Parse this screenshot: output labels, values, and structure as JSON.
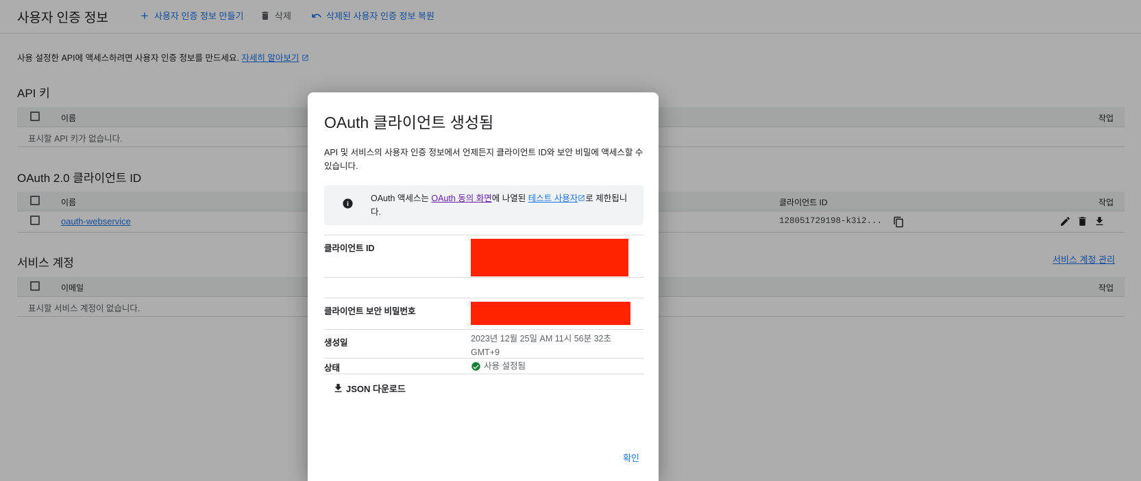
{
  "header": {
    "title": "사용자 인증 정보",
    "create_label": "사용자 인증 정보 만들기",
    "delete_label": "삭제",
    "restore_label": "삭제된 사용자 인증 정보 복원"
  },
  "intro": {
    "text": "사용 설정한 API에 액세스하려면 사용자 인증 정보를 만드세요.",
    "link": "자세히 알아보기"
  },
  "api_keys": {
    "title": "API 키",
    "col_name": "이름",
    "col_action": "작업",
    "empty": "표시할 API 키가 없습니다."
  },
  "oauth": {
    "title": "OAuth 2.0 클라이언트 ID",
    "col_name": "이름",
    "col_client_id": "클라이언트 ID",
    "col_action": "작업",
    "rows": [
      {
        "name": "oauth-webservice",
        "client_id": "128051729198-k3i2..."
      }
    ]
  },
  "service_accounts": {
    "title": "서비스 계정",
    "manage_link": "서비스 계정 관리",
    "col_email": "이메일",
    "col_action": "작업",
    "empty": "표시할 서비스 계정이 없습니다."
  },
  "dialog": {
    "title": "OAuth 클라이언트 생성됨",
    "description": "API 및 서비스의 사용자 인증 정보에서 언제든지 클라이언트 ID와 보안 비밀에 액세스할 수 있습니다.",
    "info": {
      "prefix": "OAuth 액세스는 ",
      "consent_link": "OAuth 동의 화면",
      "middle": "에 나열된 ",
      "test_users_link": "테스트 사용자",
      "suffix": "로 제한됩니다."
    },
    "fields": {
      "client_id_label": "클라이언트 ID",
      "client_secret_label": "클라이언트 보안 비밀번호",
      "created_label": "생성일",
      "created_value": "2023년 12월 25일 AM 11시 56분 32초 GMT+9",
      "status_label": "상태",
      "status_value": "사용 설정됨"
    },
    "json_download": "JSON 다운로드",
    "ok": "확인"
  },
  "colors": {
    "accent": "#1a73e8",
    "visited_link": "#681da8",
    "success": "#188038",
    "redaction": "#ff2300"
  }
}
